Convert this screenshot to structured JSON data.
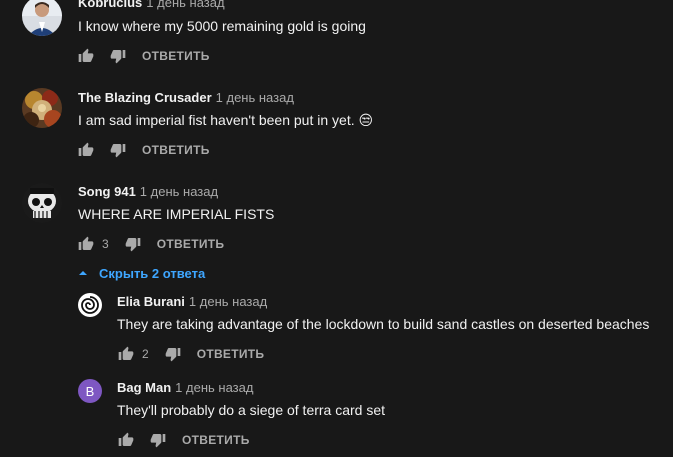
{
  "comments": [
    {
      "author": "Kobrucius",
      "time": "1 день назад",
      "text": "I know where my 5000 remaining gold is going",
      "likes": "",
      "reply_label": "ОТВЕТИТЬ",
      "avatar_icon": "portrait-avatar-icon"
    },
    {
      "author": "The Blazing Crusader",
      "time": "1 день назад",
      "text": "I am sad imperial fist haven't been put in yet. 😒",
      "likes": "",
      "reply_label": "ОТВЕТИТЬ",
      "avatar_icon": "crusader-avatar-icon"
    },
    {
      "author": "Song 941",
      "time": "1 день назад",
      "text": "WHERE ARE IMPERIAL FISTS",
      "likes": "3",
      "reply_label": "ОТВЕТИТЬ",
      "avatar_icon": "skull-avatar-icon"
    }
  ],
  "replies_toggle": "Скрыть 2 ответа",
  "replies": [
    {
      "author": "Elia Burani",
      "time": "1 день назад",
      "text": "They are taking advantage of the lockdown to build sand castles on deserted beaches",
      "likes": "2",
      "reply_label": "ОТВЕТИТЬ",
      "avatar_icon": "swirl-avatar-icon"
    },
    {
      "author": "Bag Man",
      "time": "1 день назад",
      "text": "They'll probably do a siege of terra card set",
      "likes": "",
      "reply_label": "ОТВЕТИТЬ",
      "avatar_letter": "B",
      "avatar_color": "#7e57c2"
    }
  ],
  "colors": {
    "background": "#181818",
    "link": "#3ea6ff",
    "muted": "#aaaaaa",
    "text": "#f1f1f1"
  }
}
